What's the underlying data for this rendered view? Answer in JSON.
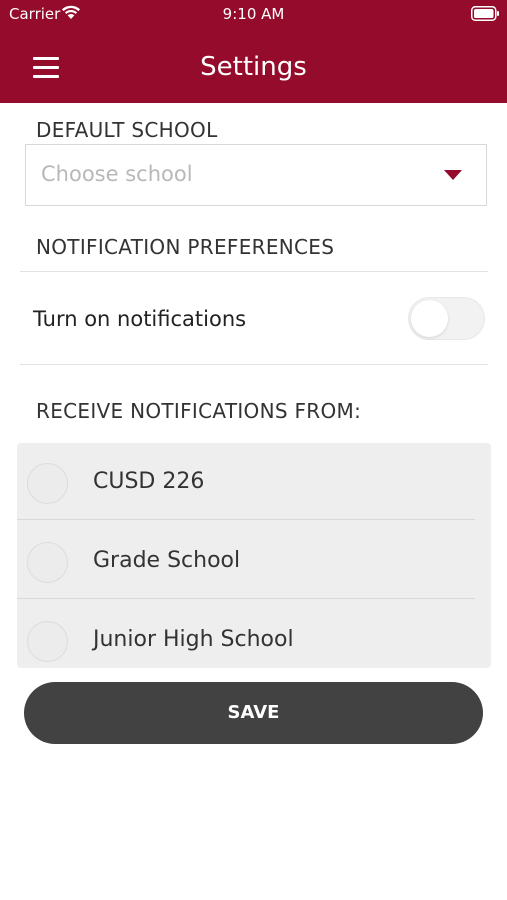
{
  "status_bar": {
    "carrier": "Carrier",
    "time": "9:10 AM",
    "wifi_icon": "wifi-icon",
    "battery_icon": "battery-icon"
  },
  "header": {
    "title": "Settings",
    "menu_icon": "hamburger-menu-icon",
    "background_color": "#940b2b"
  },
  "default_school": {
    "label": "DEFAULT SCHOOL",
    "placeholder": "Choose school",
    "caret_icon": "caret-down-icon",
    "caret_color": "#940b2b"
  },
  "notification_preferences": {
    "label": "NOTIFICATION PREFERENCES",
    "toggle_label": "Turn on notifications",
    "toggle_on": false
  },
  "receive_from": {
    "label": "RECEIVE NOTIFICATIONS FROM:",
    "schools": [
      {
        "name": "CUSD 226",
        "selected": false
      },
      {
        "name": "Grade School",
        "selected": false
      },
      {
        "name": "Junior High School",
        "selected": false
      }
    ]
  },
  "save_button": {
    "label": "SAVE",
    "color": "#424242"
  }
}
